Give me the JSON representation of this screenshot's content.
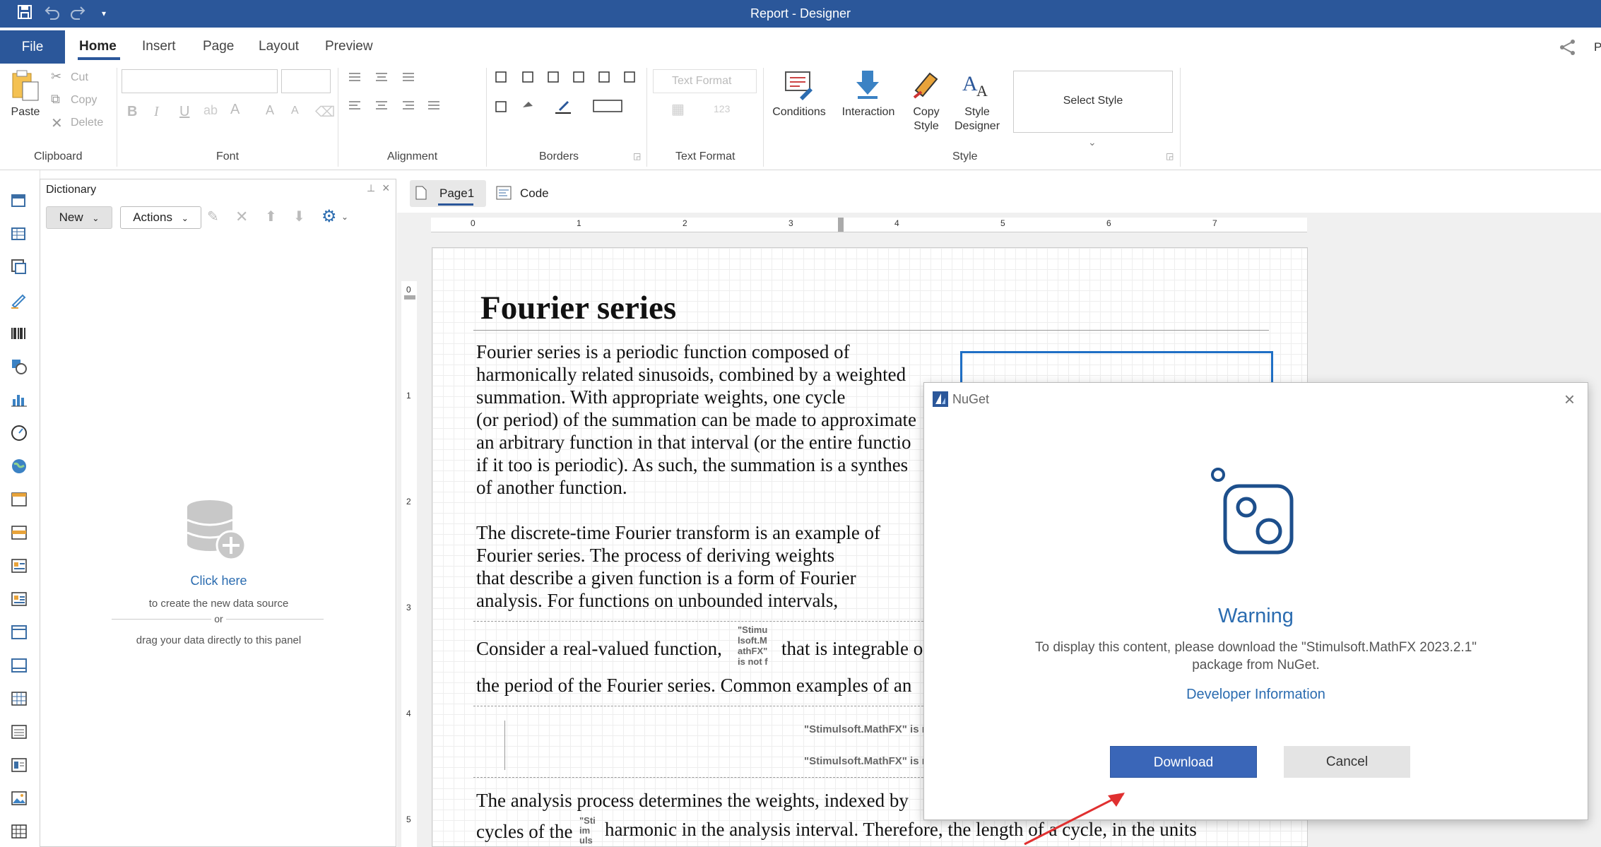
{
  "window": {
    "title": "Report - Designer"
  },
  "ribbon_tabs": [
    "File",
    "Home",
    "Insert",
    "Page",
    "Layout",
    "Preview"
  ],
  "ribbon": {
    "clipboard": {
      "paste": "Paste",
      "cut": "Cut",
      "copy": "Copy",
      "delete": "Delete",
      "label": "Clipboard"
    },
    "font": {
      "label": "Font",
      "bold": "B",
      "italic": "I",
      "underline": "U"
    },
    "alignment": {
      "label": "Alignment"
    },
    "borders": {
      "label": "Borders"
    },
    "text_format": {
      "combo": "Text Format",
      "label": "Text Format",
      "num": "123"
    },
    "style": {
      "conditions": "Conditions",
      "interaction": "Interaction",
      "copy_style_1": "Copy",
      "copy_style_2": "Style",
      "style_designer_1": "Style",
      "style_designer_2": "Designer",
      "select_style": "Select Style",
      "label": "Style"
    },
    "right_edge": "P"
  },
  "dictionary": {
    "title": "Dictionary",
    "new_label": "New",
    "actions_label": "Actions",
    "click_here": "Click here",
    "create_hint": "to create the new data source",
    "or": "or",
    "drag_hint": "drag your data directly to this panel"
  },
  "page_tabs": {
    "page1": "Page1",
    "code": "Code"
  },
  "ruler": {
    "h": [
      "0",
      "1",
      "2",
      "3",
      "4",
      "5",
      "6",
      "7"
    ],
    "v": [
      "0",
      "1",
      "2",
      "3",
      "4",
      "5"
    ]
  },
  "document": {
    "title": "Fourier series",
    "para1": [
      "Fourier series is a periodic function composed of",
      "harmonically related sinusoids, combined by a weighted",
      "summation. With appropriate weights, one cycle",
      "(or period) of the summation can be made to approximate",
      "an arbitrary function in that interval (or the entire functio",
      "if it too is periodic). As such, the summation is a synthes",
      "of another function."
    ],
    "para2": [
      "The discrete-time Fourier transform is an example of",
      "Fourier series. The process of deriving weights",
      "that describe a given function is a form of Fourier",
      "analysis. For functions on unbounded intervals,"
    ],
    "line_consider_a": "Consider a real-valued function,",
    "line_consider_b": "that is integrable o",
    "inline_placeholder_1": "\"Stimu\nlsoft.M\nathFX\"\nis not f",
    "line_period": "the period of the Fourier series. Common examples of an",
    "mathfx_1": "\"Stimulsoft.MathFX\" is n",
    "mathfx_2": "\"Stimulsoft.MathFX\" is n",
    "line_analysis": "The analysis process determines the weights, indexed by",
    "line_cycles_a": "cycles of the",
    "inline_placeholder_2": "\"Sti\nim\nuls",
    "line_cycles_b": "harmonic in the analysis interval. Therefore, the length of a cycle, in the units"
  },
  "dialog": {
    "title": "NuGet",
    "close": "×",
    "heading": "Warning",
    "message_line1": "To display this content, please download the \"Stimulsoft.MathFX 2023.2.1\"",
    "message_line2": "package from NuGet.",
    "link": "Developer Information",
    "download": "Download",
    "cancel": "Cancel"
  },
  "colors": {
    "accent": "#2b579a",
    "link": "#2b6cb0",
    "download_bg": "#3a66b8",
    "annotation_arrow": "#e03030"
  }
}
